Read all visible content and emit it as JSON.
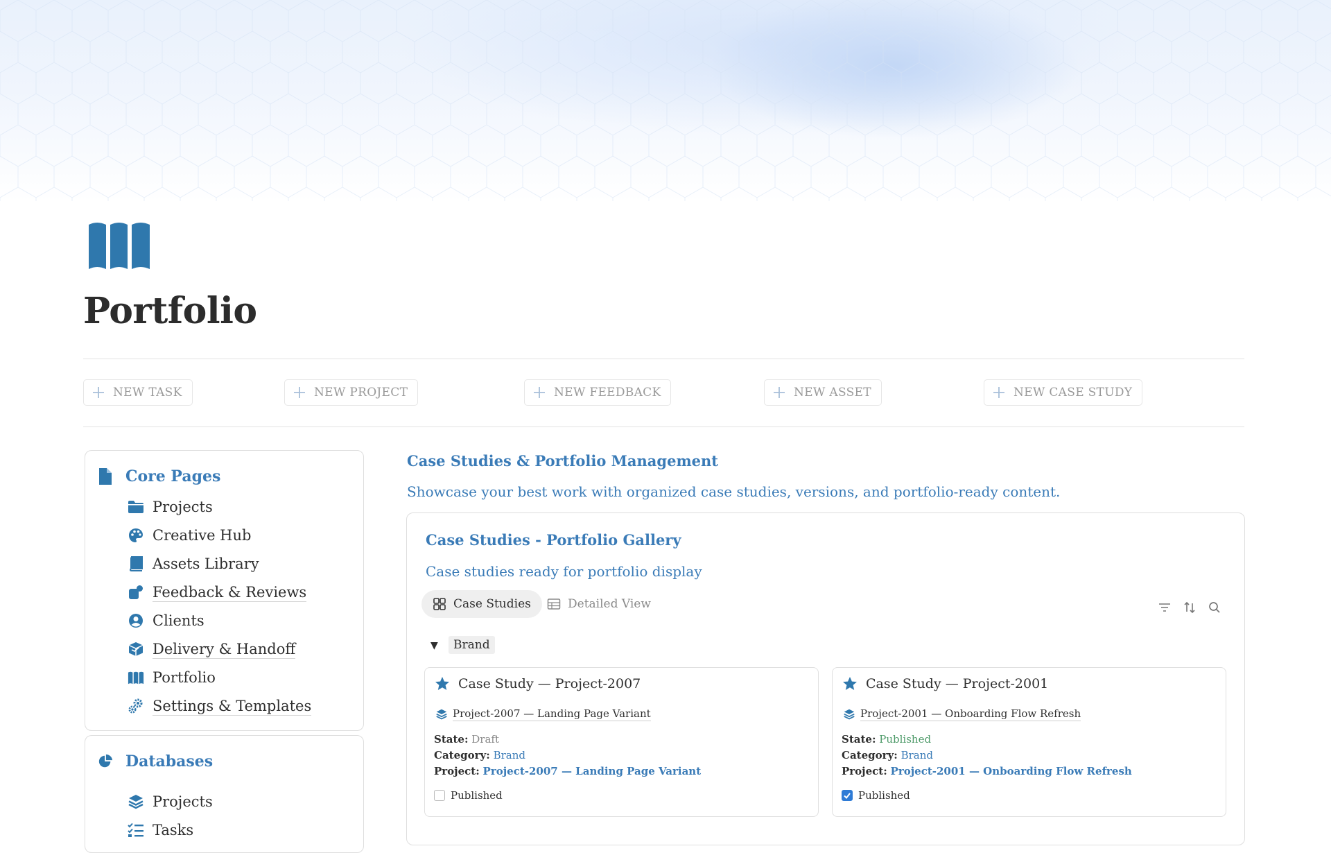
{
  "page": {
    "title": "Portfolio",
    "icon": "map-book-icon"
  },
  "colors": {
    "accent": "#3a7bb7",
    "text": "#2f2f2f",
    "muted": "#9a9a9a",
    "published_green": "#4f9b6a",
    "checkbox_blue": "#2e7bd6"
  },
  "actions": [
    {
      "label": "NEW TASK"
    },
    {
      "label": "NEW PROJECT"
    },
    {
      "label": "NEW FEEDBACK"
    },
    {
      "label": "NEW ASSET"
    },
    {
      "label": "NEW CASE STUDY"
    }
  ],
  "core_pages": {
    "title": "Core Pages",
    "items": [
      {
        "label": "Projects",
        "icon": "folder-icon"
      },
      {
        "label": "Creative Hub",
        "icon": "palette-icon"
      },
      {
        "label": "Assets Library",
        "icon": "book-icon"
      },
      {
        "label": "Feedback & Reviews",
        "icon": "feedback-icon"
      },
      {
        "label": "Clients",
        "icon": "user-circle-icon"
      },
      {
        "label": "Delivery & Handoff",
        "icon": "package-icon"
      },
      {
        "label": "Portfolio",
        "icon": "map-icon"
      },
      {
        "label": "Settings & Templates",
        "icon": "gears-icon"
      }
    ]
  },
  "databases": {
    "title": "Databases",
    "items": [
      {
        "label": "Projects",
        "icon": "layers-icon"
      },
      {
        "label": "Tasks",
        "icon": "checklist-icon"
      }
    ]
  },
  "main": {
    "title": "Case Studies & Portfolio Management",
    "description": "Showcase your best work with organized case studies, versions, and portfolio-ready content."
  },
  "gallery": {
    "title": "Case Studies - Portfolio Gallery",
    "description": "Case studies ready for portfolio display",
    "tabs": [
      {
        "label": "Case Studies",
        "active": true
      },
      {
        "label": "Detailed View",
        "active": false
      }
    ],
    "group": {
      "toggle": "▼",
      "label": "Brand"
    },
    "labels": {
      "state": "State:",
      "category": "Category:",
      "project": "Project:",
      "published": "Published"
    },
    "cards": [
      {
        "title": "Case Study — Project-2007",
        "relation": "Project-2007 — Landing Page Variant",
        "state": "Draft",
        "category": "Brand",
        "project": "Project-2007 — Landing Page Variant",
        "published": false
      },
      {
        "title": "Case Study — Project-2001",
        "relation": "Project-2001 — Onboarding Flow Refresh",
        "state": "Published",
        "category": "Brand",
        "project": "Project-2001 — Onboarding Flow Refresh",
        "published": true
      }
    ]
  }
}
